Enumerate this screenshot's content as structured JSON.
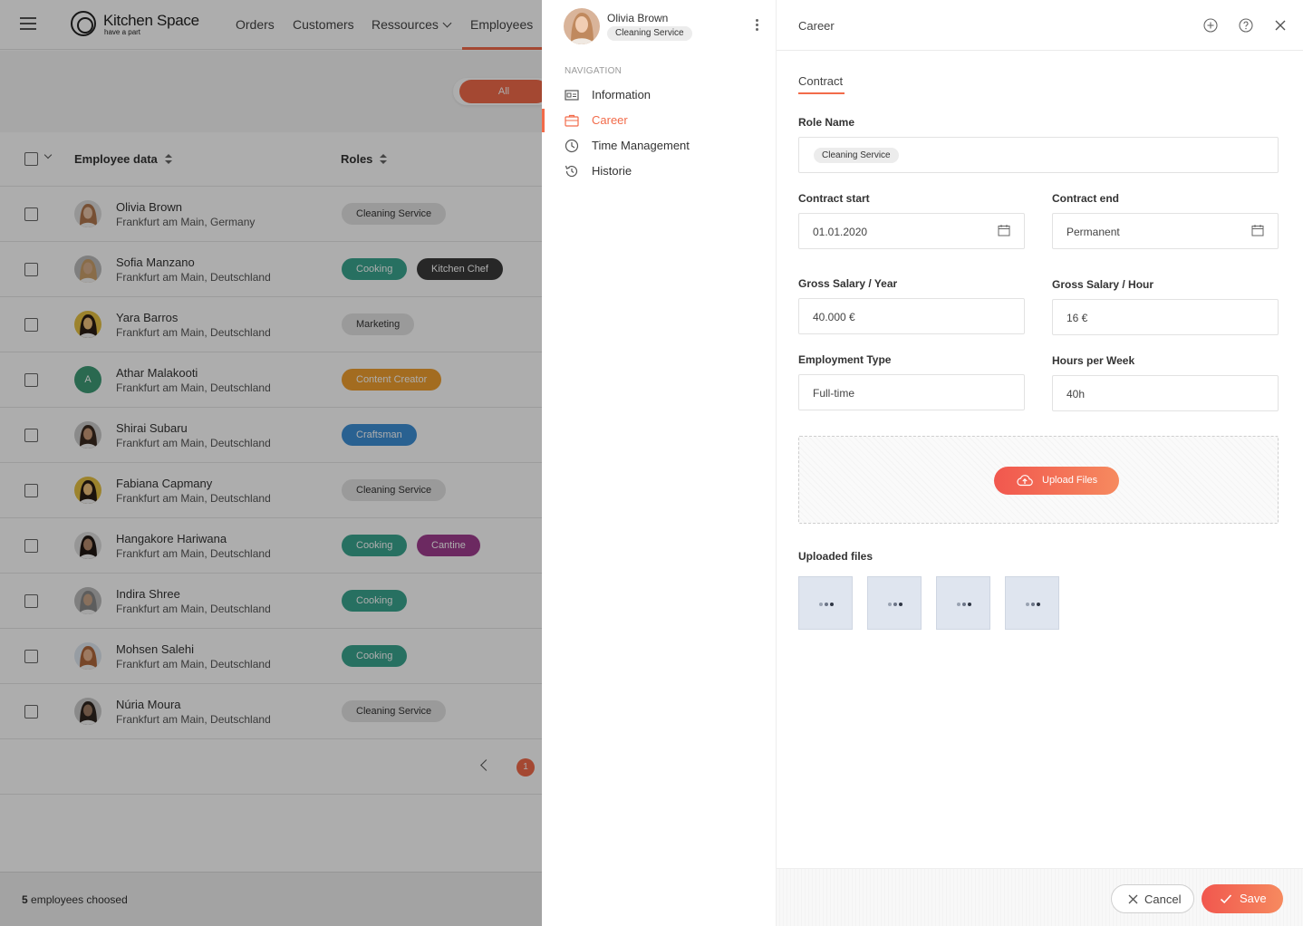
{
  "app": {
    "brand": "Kitchen Space",
    "tagline": "have a part",
    "nav": [
      "Orders",
      "Customers",
      "Ressources",
      "Employees"
    ],
    "filter_all": "All"
  },
  "table": {
    "headers": [
      "Employee data",
      "Roles"
    ],
    "rows": [
      {
        "name": "Olivia Brown",
        "location": "Frankfurt am Main, Germany",
        "tags": [
          {
            "label": "Cleaning Service",
            "color": "#e3e3e3"
          }
        ]
      },
      {
        "name": "Sofia Manzano",
        "location": "Frankfurt am Main, Deutschland",
        "tags": [
          {
            "label": "Cooking",
            "color": "#3aa58f"
          },
          {
            "label": "Kitchen Chef",
            "color": "#3a3a3a"
          }
        ]
      },
      {
        "name": "Yara Barros",
        "location": "Frankfurt am Main, Deutschland",
        "tags": [
          {
            "label": "Marketing",
            "color": "#e3e3e3"
          }
        ]
      },
      {
        "name": "Athar Malakooti",
        "location": "Frankfurt am Main, Deutschland",
        "avatar_initial": "A",
        "tags": [
          {
            "label": "Content Creator",
            "color": "#f0a030"
          }
        ]
      },
      {
        "name": "Shirai Subaru",
        "location": "Frankfurt am Main, Deutschland",
        "tags": [
          {
            "label": "Craftsman",
            "color": "#3d8fd6"
          }
        ]
      },
      {
        "name": "Fabiana Capmany",
        "location": "Frankfurt am Main, Deutschland",
        "tags": [
          {
            "label": "Cleaning Service",
            "color": "#e3e3e3"
          }
        ]
      },
      {
        "name": "Hangakore Hariwana",
        "location": "Frankfurt am Main, Deutschland",
        "tags": [
          {
            "label": "Cooking",
            "color": "#3aa58f"
          },
          {
            "label": "Cantine",
            "color": "#a03d8f"
          }
        ]
      },
      {
        "name": "Indira Shree",
        "location": "Frankfurt am Main, Deutschland",
        "tags": [
          {
            "label": "Cooking",
            "color": "#3aa58f"
          }
        ]
      },
      {
        "name": "Mohsen Salehi",
        "location": "Frankfurt am Main, Deutschland",
        "tags": [
          {
            "label": "Cooking",
            "color": "#3aa58f"
          }
        ]
      },
      {
        "name": "Núria Moura",
        "location": "Frankfurt am Main, Deutschland",
        "tags": [
          {
            "label": "Cleaning Service",
            "color": "#e3e3e3"
          }
        ]
      }
    ],
    "page": "1",
    "footer_count": "5",
    "footer_text": "employees choosed"
  },
  "panel": {
    "person_name": "Olivia Brown",
    "person_role": "Cleaning Service",
    "nav_heading": "NAVIGATION",
    "nav_items": [
      "Information",
      "Career",
      "Time Management",
      "Historie"
    ],
    "title": "Career",
    "tab": "Contract",
    "fields": {
      "role_name_label": "Role Name",
      "role_name_chip": "Cleaning Service",
      "contract_start_label": "Contract start",
      "contract_start_value": "01.01.2020",
      "contract_end_label": "Contract end",
      "contract_end_value": "Permanent",
      "gross_year_label": "Gross Salary / Year",
      "gross_year_value": "40.000 €",
      "gross_hour_label": "Gross Salary / Hour",
      "gross_hour_value": "16 €",
      "employment_type_label": "Employment Type",
      "employment_type_value": "Full-time",
      "hours_week_label": "Hours per Week",
      "hours_week_value": "40h"
    },
    "upload_label": "Upload Files",
    "uploaded_files_label": "Uploaded files",
    "cancel_label": "Cancel",
    "save_label": "Save"
  },
  "colors": {
    "accent": "#f26b4a"
  }
}
